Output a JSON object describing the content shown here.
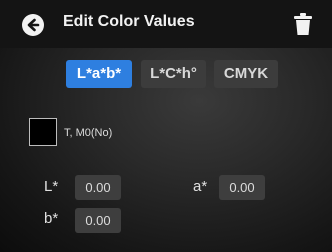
{
  "header": {
    "title": "Edit Color Values",
    "back_icon": "arrow-left-circle-icon",
    "delete_icon": "trash-icon"
  },
  "tabs": [
    {
      "label": "L*a*b*",
      "active": true
    },
    {
      "label": "L*C*h°",
      "active": false
    },
    {
      "label": "CMYK",
      "active": false
    }
  ],
  "swatch": {
    "color": "#000000",
    "label": "T, M0(No)"
  },
  "fields": {
    "L": {
      "label": "L*",
      "value": "0.00"
    },
    "a": {
      "label": "a*",
      "value": "0.00"
    },
    "b": {
      "label": "b*",
      "value": "0.00"
    }
  },
  "colors": {
    "accent": "#2e7fe0",
    "header_bg": "#141414",
    "input_bg": "#3e3e3e"
  }
}
